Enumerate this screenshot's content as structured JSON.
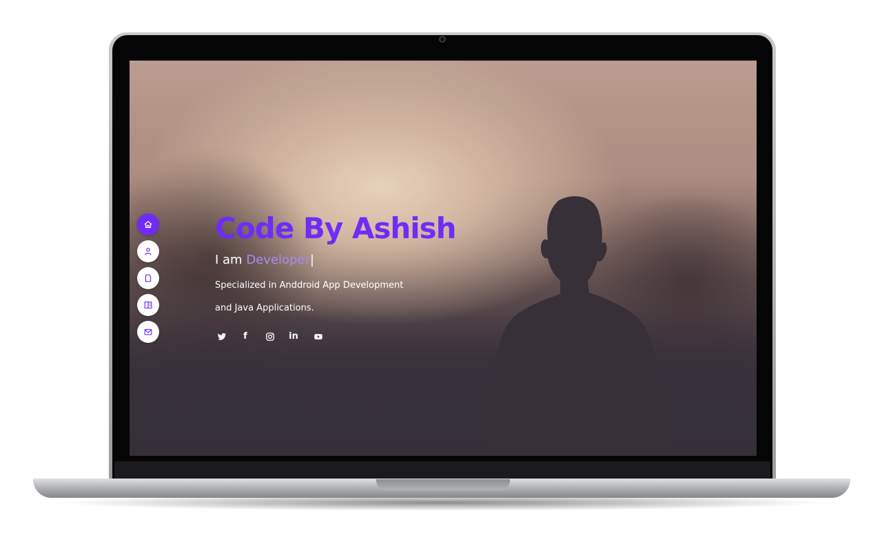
{
  "hero": {
    "title": "Code By Ashish",
    "typed_prefix": "I am ",
    "typed_role": "Developer",
    "typed_cursor": "|",
    "description_line1": "Specialized in Anddroid App Development",
    "description_line2": "and Java Applications."
  },
  "side_nav": {
    "items": [
      {
        "icon": "home-icon",
        "active": true
      },
      {
        "icon": "user-icon",
        "active": false
      },
      {
        "icon": "file-icon",
        "active": false
      },
      {
        "icon": "portfolio-book-icon",
        "active": false
      },
      {
        "icon": "envelope-icon",
        "active": false
      }
    ]
  },
  "socials": {
    "items": [
      {
        "icon": "twitter-icon"
      },
      {
        "icon": "facebook-icon",
        "label": "f"
      },
      {
        "icon": "instagram-icon"
      },
      {
        "icon": "linkedin-icon",
        "label": "in"
      },
      {
        "icon": "youtube-icon"
      }
    ]
  },
  "colors": {
    "accent": "#6f2cf7",
    "role_text": "#a98bf5",
    "text": "#ffffff"
  }
}
